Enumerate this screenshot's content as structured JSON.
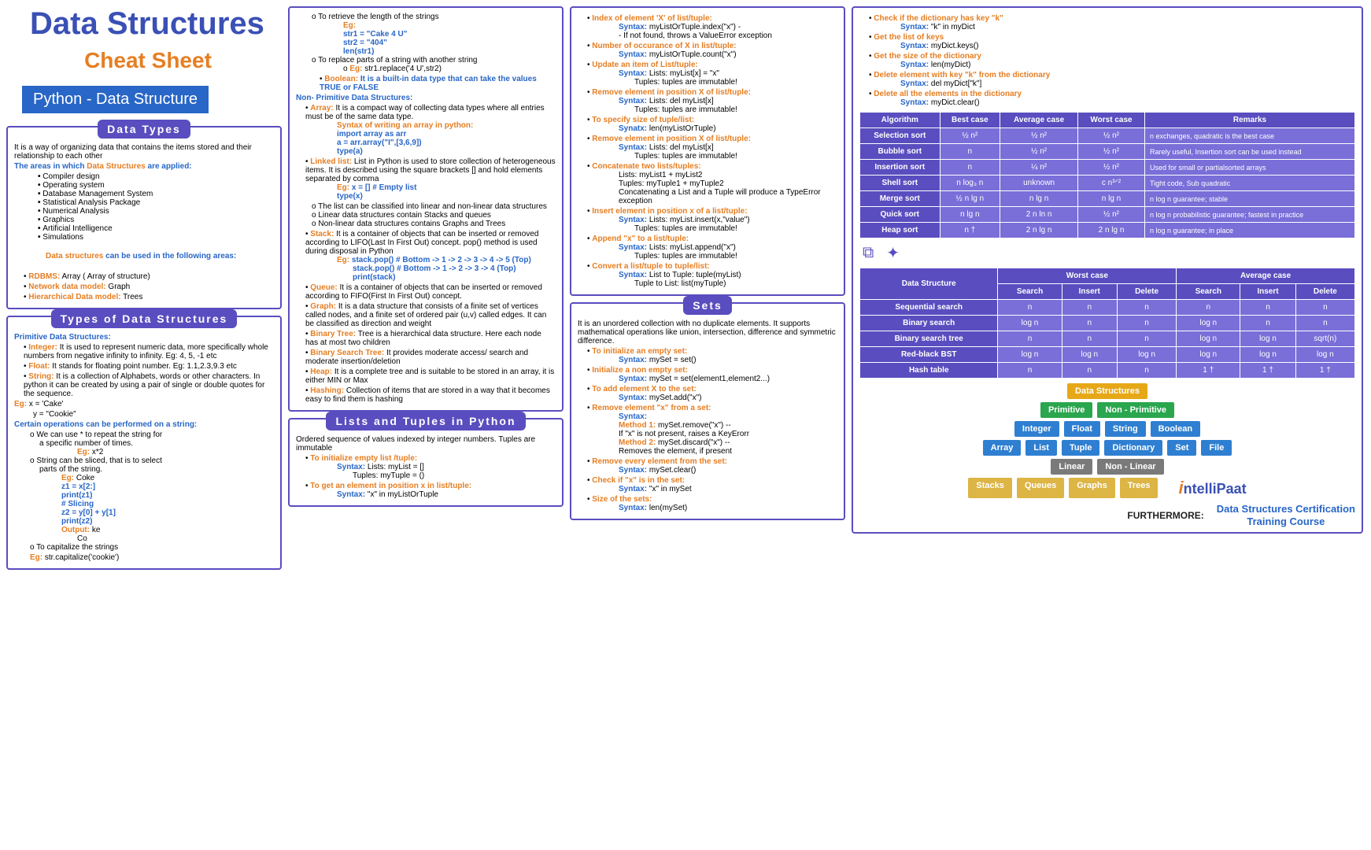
{
  "title": "Data Structures",
  "subtitle": "Cheat Sheet",
  "tag": "Python - Data Structure",
  "sections": {
    "dataTypes": {
      "head": "Data Types",
      "intro": "It is a way of organizing data that contains the items stored and their relationship to each other",
      "areasLabel": "The areas in which ",
      "areasLabel2": "Data Structures",
      "areasLabel3": " are applied:",
      "areas": [
        "Compiler design",
        "Operating system",
        "Database Management System",
        "Statistical Analysis Package",
        "Numerical Analysis",
        "Graphics",
        "Artificial Intelligence",
        "Simulations"
      ],
      "useLabel": "Data structures",
      "useLabel2": " can be used in the following areas:",
      "models": [
        {
          "name": "RDBMS:",
          "val": " Array ( Array of structure)"
        },
        {
          "name": "Network data model:",
          "val": " Graph"
        },
        {
          "name": "Hierarchical Data model:",
          "val": " Trees"
        }
      ]
    },
    "types": {
      "head": "Types of Data Structures",
      "primLabel": "Primitive Data Structures:",
      "integer": {
        "k": "Integer:",
        "v": " It is used to represent numeric data, more specifically whole numbers from negative infinity to infinity. Eg: 4, 5, -1 etc"
      },
      "float": {
        "k": "Float:",
        "v": " It stands for floating point number. Eg: 1.1,2.3,9.3 etc"
      },
      "string": {
        "k": "String:",
        "v": " It is a collection of Alphabets, words or other characters. In python it can be created by using a pair of single or double quotes for the sequence."
      },
      "stringEg": "Eg:",
      "stringEg1": " x = 'Cake'",
      "stringEg2": "y = \"Cookie\"",
      "opsLabel": "Certain operations can be performed on a string:",
      "op1": "We can use * to repeat the string for",
      "op1b": "a specific number of times.",
      "op1Eg": "Eg:",
      "op1Ex": " x*2",
      "op2": "String can be sliced, that is to select",
      "op2b": "parts of the string.",
      "op2Eg": "Eg:",
      "op2Ex": " Coke",
      "op2c1": "z1 = x[2:]",
      "op2c2": "print(z1)",
      "op2c3": "# Slicing",
      "op2c4": "z2 = y[0] + y[1]",
      "op2c5": "print(z2)",
      "op2out": "Output:",
      "op2out1": " ke",
      "op2out2": "Co",
      "op3": "To capitalize the strings",
      "op3Eg": "Eg:",
      "op3Ex": " str.capitalize('cookie')"
    },
    "col2top": {
      "retLen": "To retrieve the length of the strings",
      "retEg": "Eg:",
      "retC1": "str1 = \"Cake 4 U\"",
      "retC2": "str2 = \"404\"",
      "retC3": "len(str1)",
      "replace": "To replace parts of a string with another string",
      "replaceEg": "Eg:",
      "replaceEx": " str1.replace('4 U',str2)",
      "boolean": {
        "k": "Boolean:",
        "v": " It is a built-in data type that can take the values TRUE or FALSE"
      },
      "nonPrim": "Non- Primitive Data Structures:",
      "array": {
        "k": "Array:",
        "v": " It is a compact way of collecting data types where all entries must be of the same data type."
      },
      "arrSyn": "Syntax of writing an array in python:",
      "arrC1": "import array as arr",
      "arrC2": "a = arr.array(\"I\",[3,6,9])",
      "arrC3": "type(a)",
      "linked": {
        "k": "Linked list:",
        "v": " List in Python is used to store collection of heterogeneous items. It is described using the square brackets [] and hold elements separated by comma"
      },
      "linkedEg": "Eg:",
      "linkedC1": " x = [] # Empty list",
      "linkedC2": "type(x)",
      "listClass": "The list can be classified into linear and non-linear data structures",
      "listLin": "Linear data structures contain Stacks and queues",
      "listNon": "Non-linear data structures contains Graphs and Trees",
      "stack": {
        "k": "Stack:",
        "v": " It is a container of objects that can be inserted or removed according to LIFO(Last In First Out) concept. pop() method is used during disposal in Python"
      },
      "stackEg": "Eg:",
      "stackC1": " stack.pop() # Bottom -> 1 -> 2 -> 3 -> 4 -> 5 (Top)",
      "stackC2": "stack.pop() # Bottom -> 1 -> 2 -> 3 -> 4 (Top)",
      "stackC3": "print(stack)",
      "queue": {
        "k": "Queue:",
        "v": " It is a container of objects that can be inserted or removed according to FIFO(First In First Out) concept."
      },
      "graph": {
        "k": "Graph:",
        "v": " It is a data structure that consists of a finite set of vertices called nodes, and a finite set of ordered pair (u,v) called edges. It can be classified as direction and weight"
      },
      "btree": {
        "k": "Binary Tree:",
        "v": " Tree is a hierarchical data structure. Here each node has at most two children"
      },
      "bst": {
        "k": "Binary Search Tree:",
        "v": " It provides moderate access/ search and moderate insertion/deletion"
      },
      "heap": {
        "k": "Heap:",
        "v": " It is a complete tree and is suitable to be stored in an array, it is either MIN or Max"
      },
      "hash": {
        "k": "Hashing:",
        "v": " Collection of items that are stored in a way that it becomes easy to find them is hashing"
      }
    },
    "lists": {
      "head": "Lists and Tuples in Python",
      "intro": "Ordered sequence of values indexed by integer numbers. Tuples are immutable",
      "init": "To initialize empty list /tuple:",
      "initL": "Syntax: ",
      "initLv": "Lists: myList = []",
      "initT": "Tuples: myTuple = ()",
      "getEl": "To get an element in position x in list/tuple:",
      "getElSyn": "Syntax:",
      "getElV": " \"x\" in myListOrTuple"
    },
    "col3": {
      "idx": "Index of element 'X' of list/tuple:",
      "idxSyn": "Syntax:",
      "idxV": " myListOrTuple.index(\"x\") -",
      "idxErr": "- If not found, throws a ValueError exception",
      "occur": "Number of occurance of X in list/tuple:",
      "occurSyn": "Syntax:",
      "occurV": " myListOrTuple.count(\"x\")",
      "update": "Update an item of List/tuple:",
      "updateSyn": "Syntax:",
      "updateL": " Lists: myList[x] = \"x\"",
      "updateT": "Tuples: tuples are immutable!",
      "remPos": "Remove element in position X of list/tuple:",
      "remSyn": "Syntax:",
      "remL": " Lists: del myList[x]",
      "remT": "Tuples: tuples are immutable!",
      "size": "To specify size of tuple/list:",
      "sizeSyn": "Synatx:",
      "sizeV": " len(myListOrTuple)",
      "remPos2": "Remove element in position X of list/tuple:",
      "rem2Syn": "Syntax:",
      "rem2L": " Lists: del myList[x]",
      "rem2T": "Tuples: tuples are immutable!",
      "concat": "Concatenate two lists/tuples:",
      "concatL": "Lists: myList1 + myList2",
      "concatT": "Tuples: myTuple1 + myTuple2",
      "concatErr": "Concatenating a List and a Tuple will produce a TypeError exception",
      "insert": "Insert element in position x of a list/tuple:",
      "insertSyn": "Syntax:",
      "insertL": " Lists: myList.insert(x,\"value\")",
      "insertT": "Tuples: tuples are immutable!",
      "append": "Append \"x\" to a list/tuple:",
      "appendSyn": "Syntax:",
      "appendL": " Lists: myList.append(\"x\")",
      "appendT": "Tuples: tuples are immutable!",
      "convert": "Convert a list/tuple to tuple/list:",
      "convertSyn": "Syntax:",
      "convertL": " List to Tuple: tuple(myList)",
      "convertT": "Tuple to List: list(myTuple)"
    },
    "sets": {
      "head": "Sets",
      "intro": "It is an unordered collection with no duplicate elements. It supports mathematical operations like union, intersection, difference and symmetric difference.",
      "initE": "To initialize an empty set:",
      "initESyn": "Syntax:",
      "initEV": " mySet = set()",
      "initN": "Initialize a non empty set:",
      "initNSyn": "Syntax:",
      "initNV": " mySet = set(element1,element2...)",
      "add": "To add element X to the set:",
      "addSyn": "Syntax:",
      "addV": " mySet.add(\"x\")",
      "rem": "Remove element \"x\" from a set:",
      "remSyn": "Syntax:",
      "m1": "Method 1:",
      "m1v": " mySet.remove(\"x\") --",
      "m1e": "If \"x\" is not present, raises a KeyErorr",
      "m2": "Method 2:",
      "m2v": " mySet.discard(\"x\") --",
      "m2e": "Removes the element, if present",
      "remAll": "Remove every element from the set:",
      "remAllSyn": "Syntax:",
      "remAllV": " mySet.clear()",
      "check": "Check if \"x\" is in the set:",
      "checkSyn": "Syntax:",
      "checkV": " \"x\" in mySet",
      "sz": "Size of the sets:",
      "szSyn": "Syntax:",
      "szV": " len(mySet)"
    },
    "dict": {
      "hasKey": "Check if the dictionary has key \"k\"",
      "hasKeySyn": "Syntax:",
      "hasKeyV": " \"k\" in myDict",
      "getKeys": "Get the list of keys",
      "getKeysSyn": "Syntax:",
      "getKeysV": " myDict.keys()",
      "getSize": "Get the size of the dictionary",
      "getSizeSyn": "Syntax:",
      "getSizeV": " len(myDict)",
      "delK": "Delete element with key \"k\" from the dictionary",
      "delKSyn": "Syntax:",
      "delKV": " del myDict[\"k\"]",
      "delAll": "Delete all the elements in the dictionary",
      "delAllSyn": "Syntax:",
      "delAllV": " myDict.clear()"
    },
    "algoTable": {
      "headers": [
        "Algorithm",
        "Best case",
        "Average case",
        "Worst case",
        "Remarks"
      ],
      "rows": [
        [
          "Selection sort",
          "½ n²",
          "½ n²",
          "½ n²",
          "n exchanges, quadratic is the best case"
        ],
        [
          "Bubble sort",
          "n",
          "½ n²",
          "½ n²",
          "Rarely useful, Insertion sort can be used instead"
        ],
        [
          "Insertion sort",
          "n",
          "¼ n²",
          "½ n²",
          "Used for small or partialsorted arrays"
        ],
        [
          "Shell sort",
          "n log₃ n",
          "unknown",
          "c n³ᐟ²",
          "Tight code, Sub quadratic"
        ],
        [
          "Merge sort",
          "½ n lg n",
          "n lg n",
          "n lg n",
          "n log n guarantee; stable"
        ],
        [
          "Quick sort",
          "n lg n",
          "2 n ln n",
          "½ n²",
          "n log n probabilistic guarantee; fastest in practice"
        ],
        [
          "Heap sort",
          "n †",
          "2 n lg n",
          "2 n lg n",
          "n log n guarantee; in place"
        ]
      ]
    },
    "dsTable": {
      "topHeaders": [
        "Worst case",
        "Average case"
      ],
      "subHeaders": [
        "Data Structure",
        "Search",
        "Insert",
        "Delete",
        "Search",
        "Insert",
        "Delete"
      ],
      "rows": [
        [
          "Sequential search",
          "n",
          "n",
          "n",
          "n",
          "n",
          "n"
        ],
        [
          "Binary search",
          "log n",
          "n",
          "n",
          "log n",
          "n",
          "n"
        ],
        [
          "Binary search tree",
          "n",
          "n",
          "n",
          "log n",
          "log n",
          "sqrt(n)"
        ],
        [
          "Red-black BST",
          "log n",
          "log n",
          "log n",
          "log n",
          "log n",
          "log n"
        ],
        [
          "Hash table",
          "n",
          "n",
          "n",
          "1 †",
          "1 †",
          "1 †"
        ]
      ]
    },
    "tree": {
      "root": "Data Structures",
      "l1": [
        "Primitive",
        "Non - Primitive"
      ],
      "l2a": [
        "Integer",
        "Float",
        "String",
        "Boolean"
      ],
      "l2b": [
        "Array",
        "List",
        "Tuple",
        "Dictionary",
        "Set",
        "File"
      ],
      "l3": [
        "Linear",
        "Non - Linear"
      ],
      "l4": [
        "Stacks",
        "Queues",
        "Graphs",
        "Trees"
      ]
    },
    "footer": {
      "further": "FURTHERMORE:",
      "cta1": "Data Structures Certification",
      "cta2": "Training Course",
      "logoI": "i",
      "logoRest": "ntelliPaat"
    }
  }
}
